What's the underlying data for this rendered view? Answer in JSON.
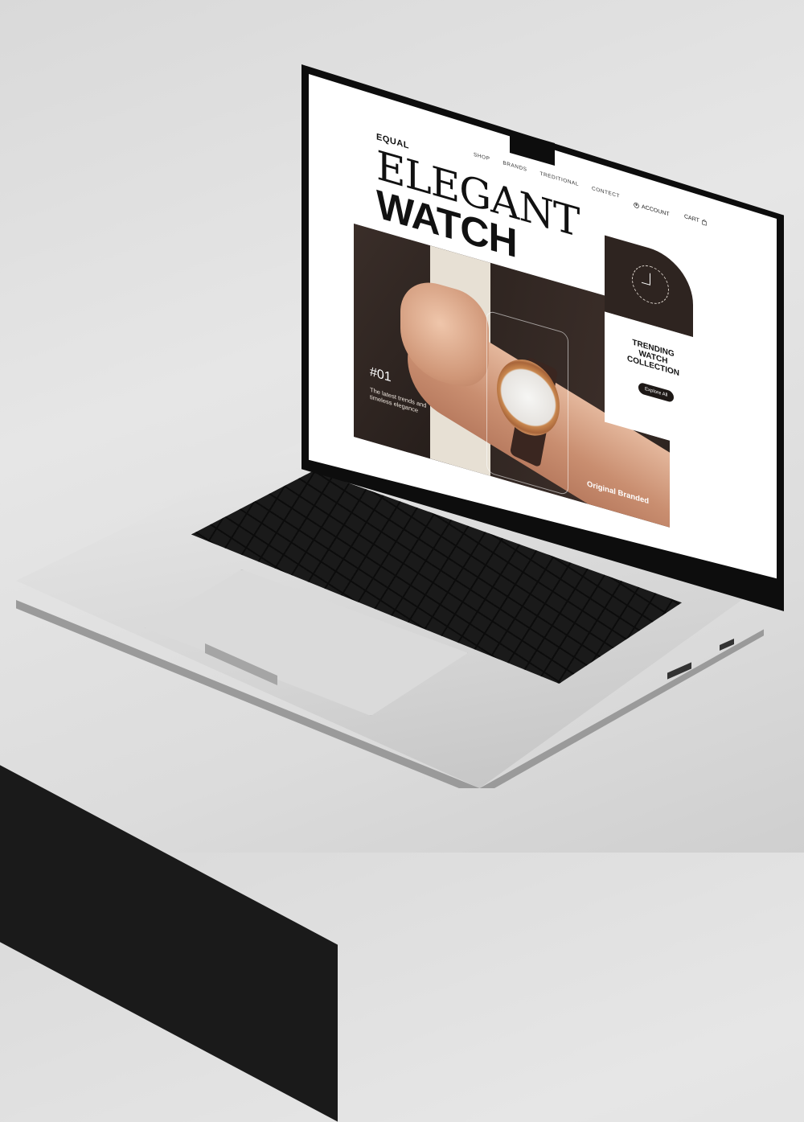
{
  "site": {
    "logo": "EQUAL",
    "nav": [
      "SHOP",
      "BRANDS",
      "TREDITIONAL",
      "CONTECT"
    ],
    "account_label": "ACCOUNT",
    "cart_label": "CART"
  },
  "hero": {
    "title_line1": "ELEGANT",
    "title_line2": "WATCH",
    "slide_number": "#01",
    "tagline": "The latest trends and timeless elegance",
    "badge": "Original Branded"
  },
  "trending_card": {
    "title": "TRENDING WATCH COLLECTION",
    "button_label": "Explore All"
  },
  "colors": {
    "dark_brown": "#2e2420",
    "white": "#ffffff",
    "text_dark": "#111111"
  },
  "icons": {
    "account": "user-circle-icon",
    "cart": "bag-icon"
  }
}
